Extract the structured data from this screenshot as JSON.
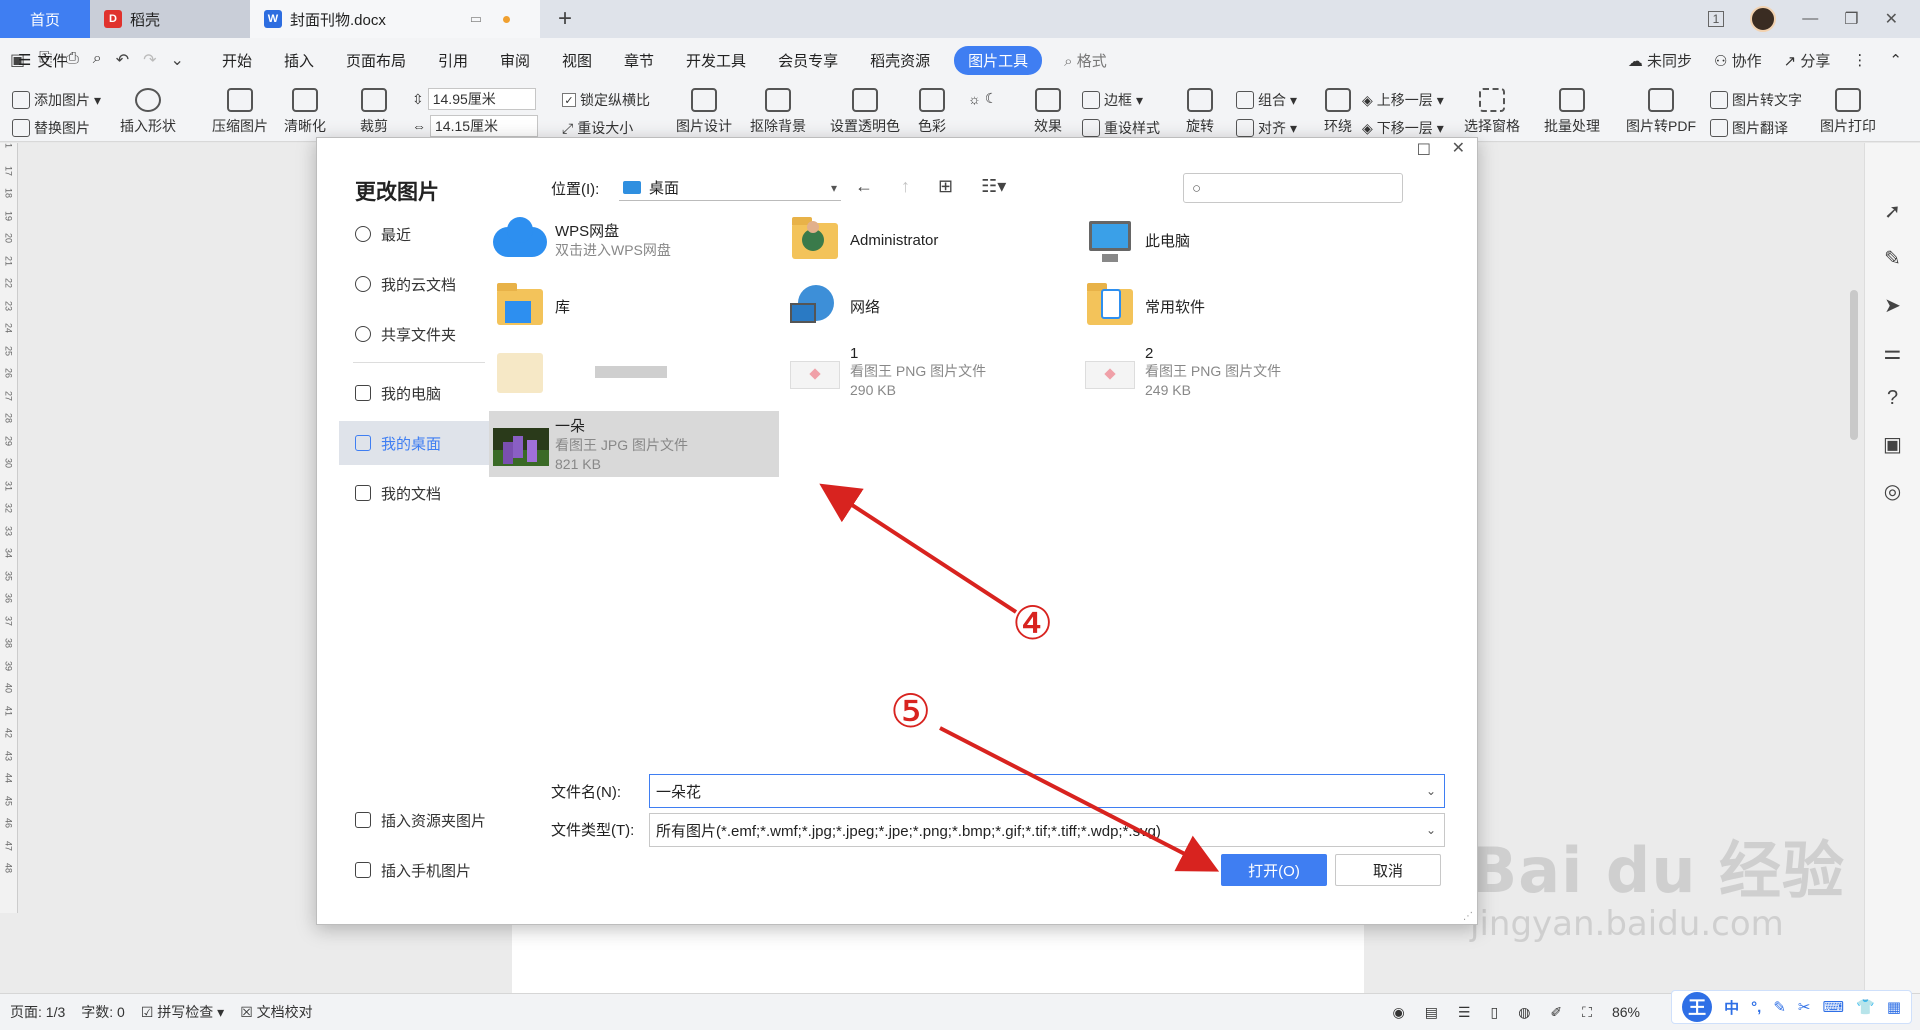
{
  "tabs": {
    "home": "首页",
    "daoke": "稻壳",
    "doc": "封面刊物.docx",
    "add": "+"
  },
  "window": {
    "page_count_icon": "1",
    "minimize": "—",
    "restore": "❐",
    "close": "✕"
  },
  "menu": {
    "file": "文件",
    "items": [
      "开始",
      "插入",
      "页面布局",
      "引用",
      "审阅",
      "视图",
      "章节",
      "开发工具",
      "会员专享",
      "稻壳资源"
    ],
    "active": "图片工具",
    "search": "格式",
    "right": {
      "sync": "未同步",
      "collab": "协作",
      "share": "分享"
    }
  },
  "ribbon": {
    "add_image": "添加图片",
    "replace_image": "替换图片",
    "insert_shape": "插入形状",
    "compress": "压缩图片",
    "clarify": "清晰化",
    "crop": "裁剪",
    "width": "14.95厘米",
    "height": "14.15厘米",
    "lock_ratio": "锁定纵横比",
    "reset_size": "重设大小",
    "image_design": "图片设计",
    "remove_bg": "抠除背景",
    "set_transparent": "设置透明色",
    "color": "色彩",
    "effects": "效果",
    "border": "边框",
    "reset_style": "重设样式",
    "rotate": "旋转",
    "group": "组合",
    "align": "对齐",
    "wrap": "环绕",
    "bring_forward": "上移一层",
    "send_backward": "下移一层",
    "select_pane": "选择窗格",
    "batch": "批量处理",
    "to_pdf": "图片转PDF",
    "to_text": "图片转文字",
    "translate": "图片翻译",
    "print": "图片打印"
  },
  "ruler_numbers": [
    "1",
    "17",
    "18",
    "19",
    "20",
    "21",
    "22",
    "23",
    "24",
    "25",
    "26",
    "27",
    "28",
    "29",
    "30",
    "31",
    "32",
    "33",
    "34",
    "35",
    "36",
    "37",
    "38",
    "39",
    "40",
    "41",
    "42",
    "43",
    "44",
    "45",
    "46",
    "47",
    "48"
  ],
  "dialog": {
    "title": "更改图片",
    "location_label": "位置(I):",
    "location_value": "桌面",
    "sidebar": [
      {
        "label": "最近",
        "icon": "clock-icon"
      },
      {
        "label": "我的云文档",
        "icon": "cloud-doc-icon"
      },
      {
        "label": "共享文件夹",
        "icon": "share-folder-icon"
      },
      {
        "label": "我的电脑",
        "icon": "computer-icon"
      },
      {
        "label": "我的桌面",
        "icon": "desktop-icon"
      },
      {
        "label": "我的文档",
        "icon": "documents-icon"
      }
    ],
    "sidebar_bottom": [
      "插入资源夹图片",
      "插入手机图片"
    ],
    "files": [
      {
        "name": "WPS网盘",
        "sub": "双击进入WPS网盘"
      },
      {
        "name": "Administrator"
      },
      {
        "name": "此电脑"
      },
      {
        "name": "库"
      },
      {
        "name": "网络"
      },
      {
        "name": "常用软件"
      },
      {
        "name": "1",
        "type": "看图王 PNG 图片文件",
        "size": "290 KB"
      },
      {
        "name": "2",
        "type": "看图王 PNG 图片文件",
        "size": "249 KB"
      },
      {
        "name": "一朵",
        "type": "看图王 JPG 图片文件",
        "size": "821 KB"
      }
    ],
    "filename_label": "文件名(N):",
    "filename_value": "一朵花",
    "filetype_label": "文件类型(T):",
    "filetype_value": "所有图片(*.emf;*.wmf;*.jpg;*.jpeg;*.jpe;*.png;*.bmp;*.gif;*.tif;*.tiff;*.wdp;*.svg)",
    "open_button": "打开(O)",
    "cancel_button": "取消"
  },
  "annotations": {
    "step4": "④",
    "step5": "⑤",
    "color": "#d8231f"
  },
  "status": {
    "page": "页面: 1/3",
    "words": "字数: 0",
    "spell": "拼写检查",
    "proof": "文档校对",
    "zoom": "86%"
  },
  "ime": {
    "brand": "王",
    "lang": "中"
  },
  "watermark": {
    "main": "Bai du 经验",
    "sub": "jingyan.baidu.com"
  },
  "colors": {
    "accent": "#3f7ef2",
    "annotation": "#d8231f"
  }
}
